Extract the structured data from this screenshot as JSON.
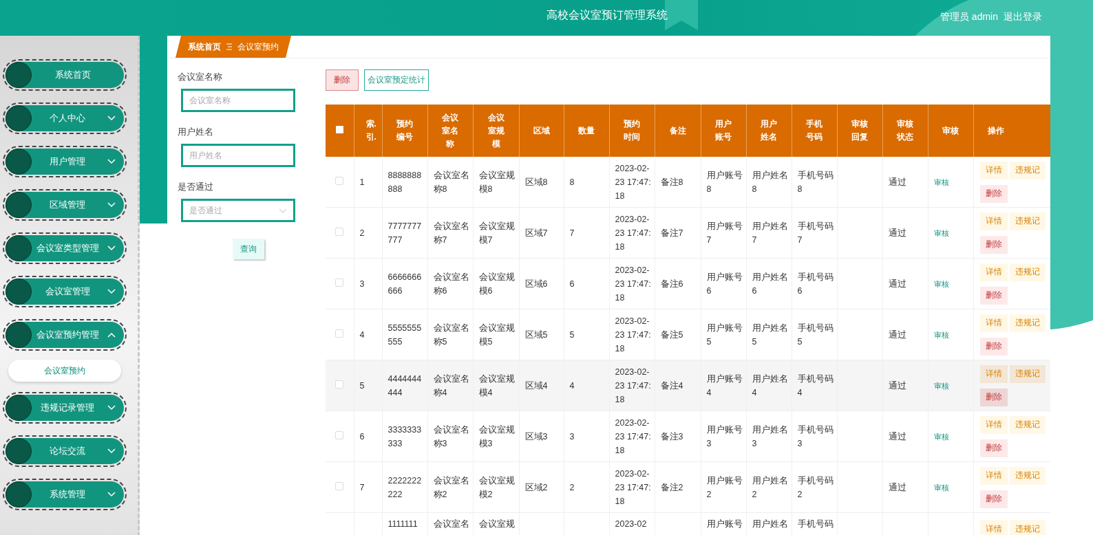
{
  "header": {
    "title": "高校会议室预订管理系统",
    "user": "管理员 admin",
    "logout": "退出登录"
  },
  "sidebar": {
    "items": [
      {
        "label": "系统首页",
        "has_children": false
      },
      {
        "label": "个人中心",
        "has_children": true,
        "expanded": false
      },
      {
        "label": "用户管理",
        "has_children": true,
        "expanded": false
      },
      {
        "label": "区域管理",
        "has_children": true,
        "expanded": false
      },
      {
        "label": "会议室类型管理",
        "has_children": true,
        "expanded": false
      },
      {
        "label": "会议室管理",
        "has_children": true,
        "expanded": false
      },
      {
        "label": "会议室预约管理",
        "has_children": true,
        "expanded": true,
        "children": [
          {
            "label": "会议室预约",
            "selected": true
          }
        ]
      },
      {
        "label": "违规记录管理",
        "has_children": true,
        "expanded": false
      },
      {
        "label": "论坛交流",
        "has_children": true,
        "expanded": false
      },
      {
        "label": "系统管理",
        "has_children": true,
        "expanded": false
      }
    ]
  },
  "breadcrumb": [
    "系统首页",
    "会议室预约"
  ],
  "search": {
    "fields": [
      {
        "kind": "text",
        "label": "会议室名称",
        "placeholder": "会议室名称"
      },
      {
        "kind": "text",
        "label": "用户姓名",
        "placeholder": "用户姓名"
      },
      {
        "kind": "select",
        "label": "是否通过",
        "placeholder": "是否通过"
      }
    ],
    "button": "查询"
  },
  "toolbar": [
    {
      "kind": "danger",
      "label": "删除"
    },
    {
      "kind": "outline",
      "label": "会议室预定统计"
    }
  ],
  "table": {
    "all_checked": false,
    "columns": [
      "索.引.",
      "预约编号",
      "会议室名称",
      "会议室规模",
      "区域",
      "数量",
      "预约时间",
      "备注",
      "用户账号",
      "用户姓名",
      "手机号码",
      "审核回复",
      "审核状态",
      "审核",
      "操作"
    ],
    "rows": [
      {
        "checked": false,
        "highlighted": false,
        "cells": [
          "1",
          "8888888888",
          "会议室名称8",
          "会议室规模8",
          "区域8",
          "8",
          "2023-02-23 17:47:18",
          "备注8",
          "用户账号8",
          "用户姓名8",
          "手机号码8",
          "",
          "通过"
        ],
        "review": "审核",
        "actions": [
          "详情",
          "违规记",
          "删除"
        ]
      },
      {
        "checked": false,
        "highlighted": false,
        "cells": [
          "2",
          "7777777777",
          "会议室名称7",
          "会议室规模7",
          "区域7",
          "7",
          "2023-02-23 17:47:18",
          "备注7",
          "用户账号7",
          "用户姓名7",
          "手机号码7",
          "",
          "通过"
        ],
        "review": "审核",
        "actions": [
          "详情",
          "违规记",
          "删除"
        ]
      },
      {
        "checked": false,
        "highlighted": false,
        "cells": [
          "3",
          "6666666666",
          "会议室名称6",
          "会议室规模6",
          "区域6",
          "6",
          "2023-02-23 17:47:18",
          "备注6",
          "用户账号6",
          "用户姓名6",
          "手机号码6",
          "",
          "通过"
        ],
        "review": "审核",
        "actions": [
          "详情",
          "违规记",
          "删除"
        ]
      },
      {
        "checked": false,
        "highlighted": false,
        "cells": [
          "4",
          "5555555555",
          "会议室名称5",
          "会议室规模5",
          "区域5",
          "5",
          "2023-02-23 17:47:18",
          "备注5",
          "用户账号5",
          "用户姓名5",
          "手机号码5",
          "",
          "通过"
        ],
        "review": "审核",
        "actions": [
          "详情",
          "违规记",
          "删除"
        ]
      },
      {
        "checked": false,
        "highlighted": true,
        "cells": [
          "5",
          "4444444444",
          "会议室名称4",
          "会议室规模4",
          "区域4",
          "4",
          "2023-02-23 17:47:18",
          "备注4",
          "用户账号4",
          "用户姓名4",
          "手机号码4",
          "",
          "通过"
        ],
        "review": "审核",
        "actions": [
          "详情",
          "违规记",
          "删除"
        ]
      },
      {
        "checked": false,
        "highlighted": false,
        "cells": [
          "6",
          "3333333333",
          "会议室名称3",
          "会议室规模3",
          "区域3",
          "3",
          "2023-02-23 17:47:18",
          "备注3",
          "用户账号3",
          "用户姓名3",
          "手机号码3",
          "",
          "通过"
        ],
        "review": "审核",
        "actions": [
          "详情",
          "违规记",
          "删除"
        ]
      },
      {
        "checked": false,
        "highlighted": false,
        "cells": [
          "7",
          "2222222222",
          "会议室名称2",
          "会议室规模2",
          "区域2",
          "2",
          "2023-02-23 17:47:18",
          "备注2",
          "用户账号2",
          "用户姓名2",
          "手机号码2",
          "",
          "通过"
        ],
        "review": "审核",
        "actions": [
          "详情",
          "违规记",
          "删除"
        ]
      },
      {
        "cells": [
          "",
          "1111111",
          "会议室名",
          "会议室规",
          "",
          "",
          "2023-02",
          "",
          "用户账号",
          "用户姓名",
          "手机号码",
          "",
          ""
        ],
        "actions": [
          "详情",
          "违规记"
        ]
      }
    ]
  }
}
